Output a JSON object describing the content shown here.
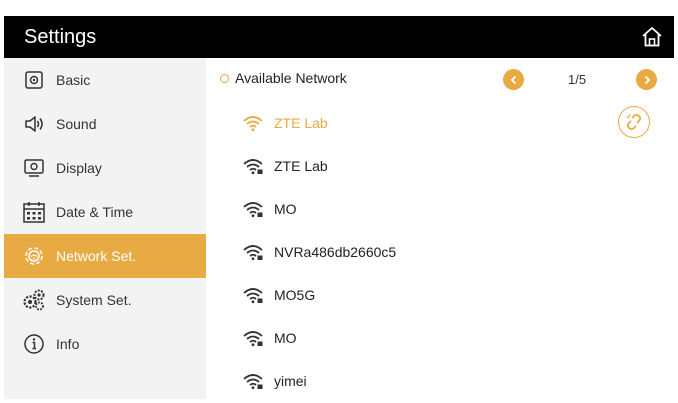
{
  "header": {
    "title": "Settings",
    "home_icon": "home-icon"
  },
  "sidebar": {
    "items": [
      {
        "label": "Basic",
        "icon": "basic-icon"
      },
      {
        "label": "Sound",
        "icon": "speaker-icon"
      },
      {
        "label": "Display",
        "icon": "display-icon"
      },
      {
        "label": "Date & Time",
        "icon": "calendar-icon"
      },
      {
        "label": "Network Set.",
        "icon": "network-gear-icon",
        "active": true
      },
      {
        "label": "System Set.",
        "icon": "gears-icon"
      },
      {
        "label": "Info",
        "icon": "info-icon"
      }
    ]
  },
  "main": {
    "section_title": "Available Network",
    "page_indicator": "1/5",
    "networks": [
      {
        "name": "ZTE Lab",
        "connected": true
      },
      {
        "name": "ZTE Lab"
      },
      {
        "name": "MO"
      },
      {
        "name": "NVRa486db2660c5"
      },
      {
        "name": "MO5G"
      },
      {
        "name": "MO"
      },
      {
        "name": "yimei"
      }
    ]
  },
  "colors": {
    "accent": "#e8aa43",
    "header_bg": "#000000",
    "sidebar_bg": "#f3f3f3"
  }
}
